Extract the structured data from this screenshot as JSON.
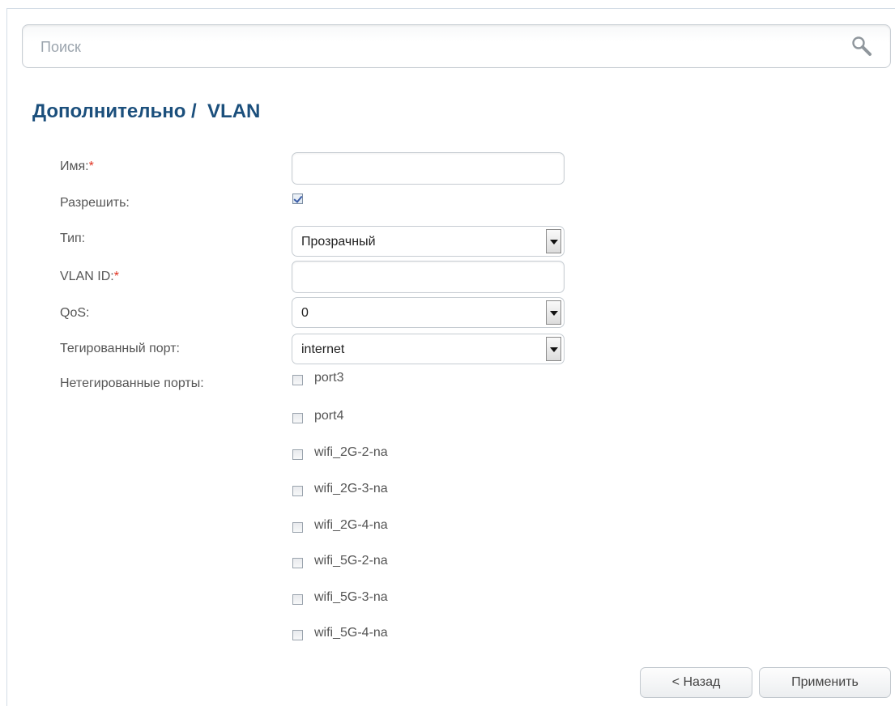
{
  "search": {
    "placeholder": "Поиск"
  },
  "page": {
    "title": "Дополнительно /  VLAN"
  },
  "form": {
    "name_label": "Имя:",
    "name_value": "",
    "enable_label": "Разрешить:",
    "enable_checked": true,
    "type_label": "Тип:",
    "type_value": "Прозрачный",
    "vlan_id_label": "VLAN ID:",
    "vlan_id_value": "",
    "qos_label": "QoS:",
    "qos_value": "0",
    "tagged_port_label": "Тегированный порт:",
    "tagged_port_value": "internet",
    "untagged_ports_label": "Нетегированные порты:",
    "required_mark": "*",
    "untagged_ports": [
      {
        "label": "port3",
        "checked": false
      },
      {
        "label": "port4",
        "checked": false
      },
      {
        "label": "wifi_2G-2-na",
        "checked": false
      },
      {
        "label": "wifi_2G-3-na",
        "checked": false
      },
      {
        "label": "wifi_2G-4-na",
        "checked": false
      },
      {
        "label": "wifi_5G-2-na",
        "checked": false
      },
      {
        "label": "wifi_5G-3-na",
        "checked": false
      },
      {
        "label": "wifi_5G-4-na",
        "checked": false
      }
    ]
  },
  "buttons": {
    "back": "< Назад",
    "apply": "Применить"
  },
  "colors": {
    "title": "#1b4f7c",
    "required": "#e0301e",
    "text": "#555555"
  }
}
